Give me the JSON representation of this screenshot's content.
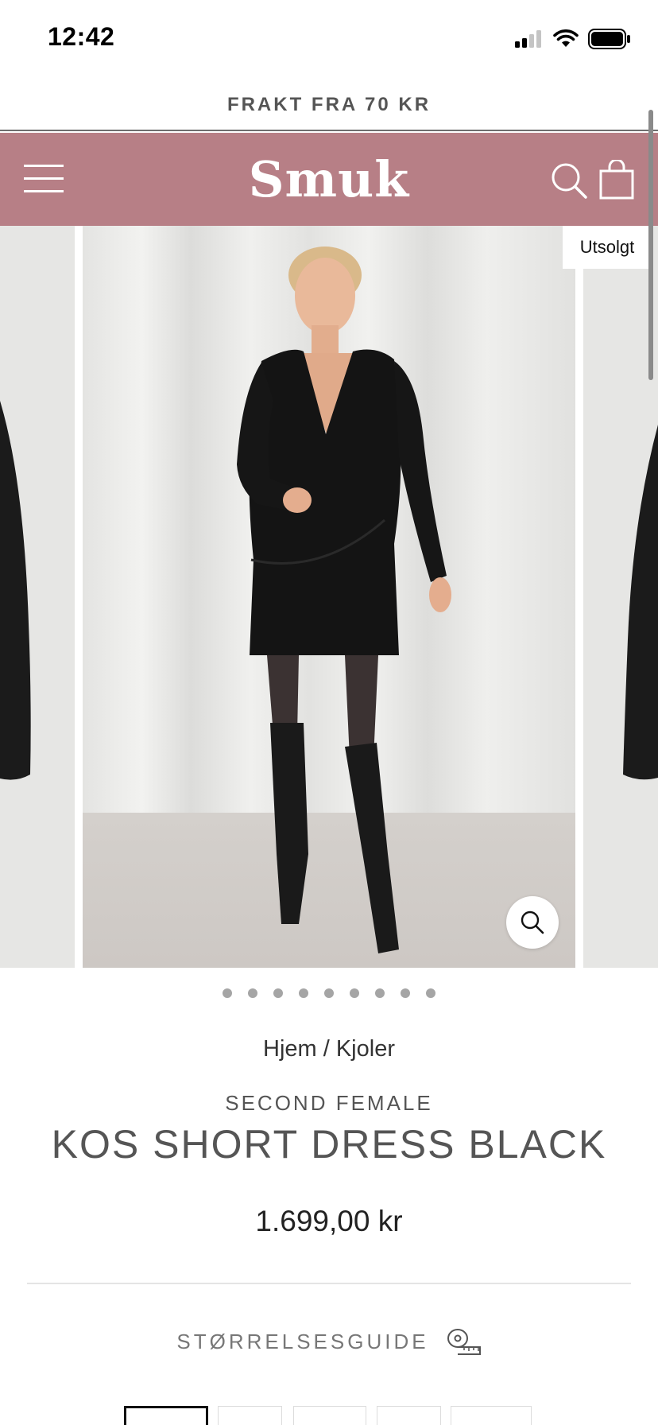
{
  "status_bar": {
    "time": "12:42"
  },
  "promo": {
    "text": "FRAKT FRA 70 KR"
  },
  "header": {
    "logo": "Smuk",
    "brand_color": "#b77f86"
  },
  "gallery": {
    "badge": "Utsolgt",
    "slide_count": 9,
    "active_slide": 1
  },
  "product": {
    "breadcrumb": {
      "home": "Hjem",
      "separator": " / ",
      "category": "Kjoler"
    },
    "vendor": "SECOND FEMALE",
    "title": "KOS SHORT DRESS BLACK",
    "price": "1.699,00 kr",
    "size_guide": "STØRRELSESGUIDE"
  },
  "icons": {
    "menu": "hamburger-menu-icon",
    "search": "search-icon",
    "cart": "shopping-bag-icon",
    "zoom": "zoom-icon",
    "size_guide": "measuring-tape-icon"
  }
}
